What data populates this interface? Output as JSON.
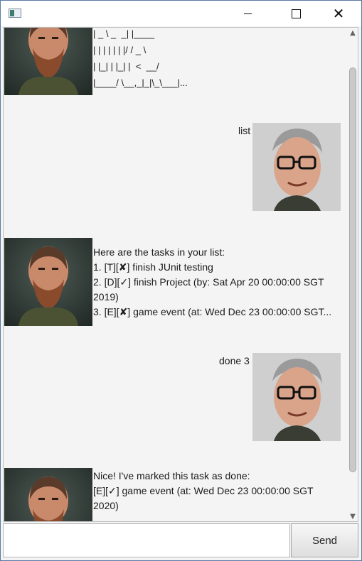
{
  "window": {
    "title": "",
    "controls": [
      "minimize",
      "maximize",
      "close"
    ]
  },
  "messages": [
    {
      "sender": "bot",
      "avatar": "bearded-man-photo",
      "text": "| _ \\ _  _| |____\n| | | | | | |/ / _ \\\n| |_| | |_| |  <  __/\n|____/ \\__,_|_|\\_\\___|..."
    },
    {
      "sender": "user",
      "avatar": "glasses-man-photo",
      "text": "list"
    },
    {
      "sender": "bot",
      "avatar": "bearded-man-photo",
      "text": "Here are the tasks in your list:\n1. [T][✘] finish JUnit testing\n2. [D][✓] finish Project (by: Sat Apr 20 00:00:00 SGT\n2019)\n3. [E][✘] game event (at: Wed Dec 23 00:00:00 SGT..."
    },
    {
      "sender": "user",
      "avatar": "glasses-man-photo",
      "text": "done 3"
    },
    {
      "sender": "bot",
      "avatar": "bearded-man-photo",
      "text": "Nice! I've marked this task as done:\n[E][✓] game event (at: Wed Dec 23 00:00:00 SGT\n2020)"
    }
  ],
  "input": {
    "value": "",
    "placeholder": ""
  },
  "send_label": "Send"
}
